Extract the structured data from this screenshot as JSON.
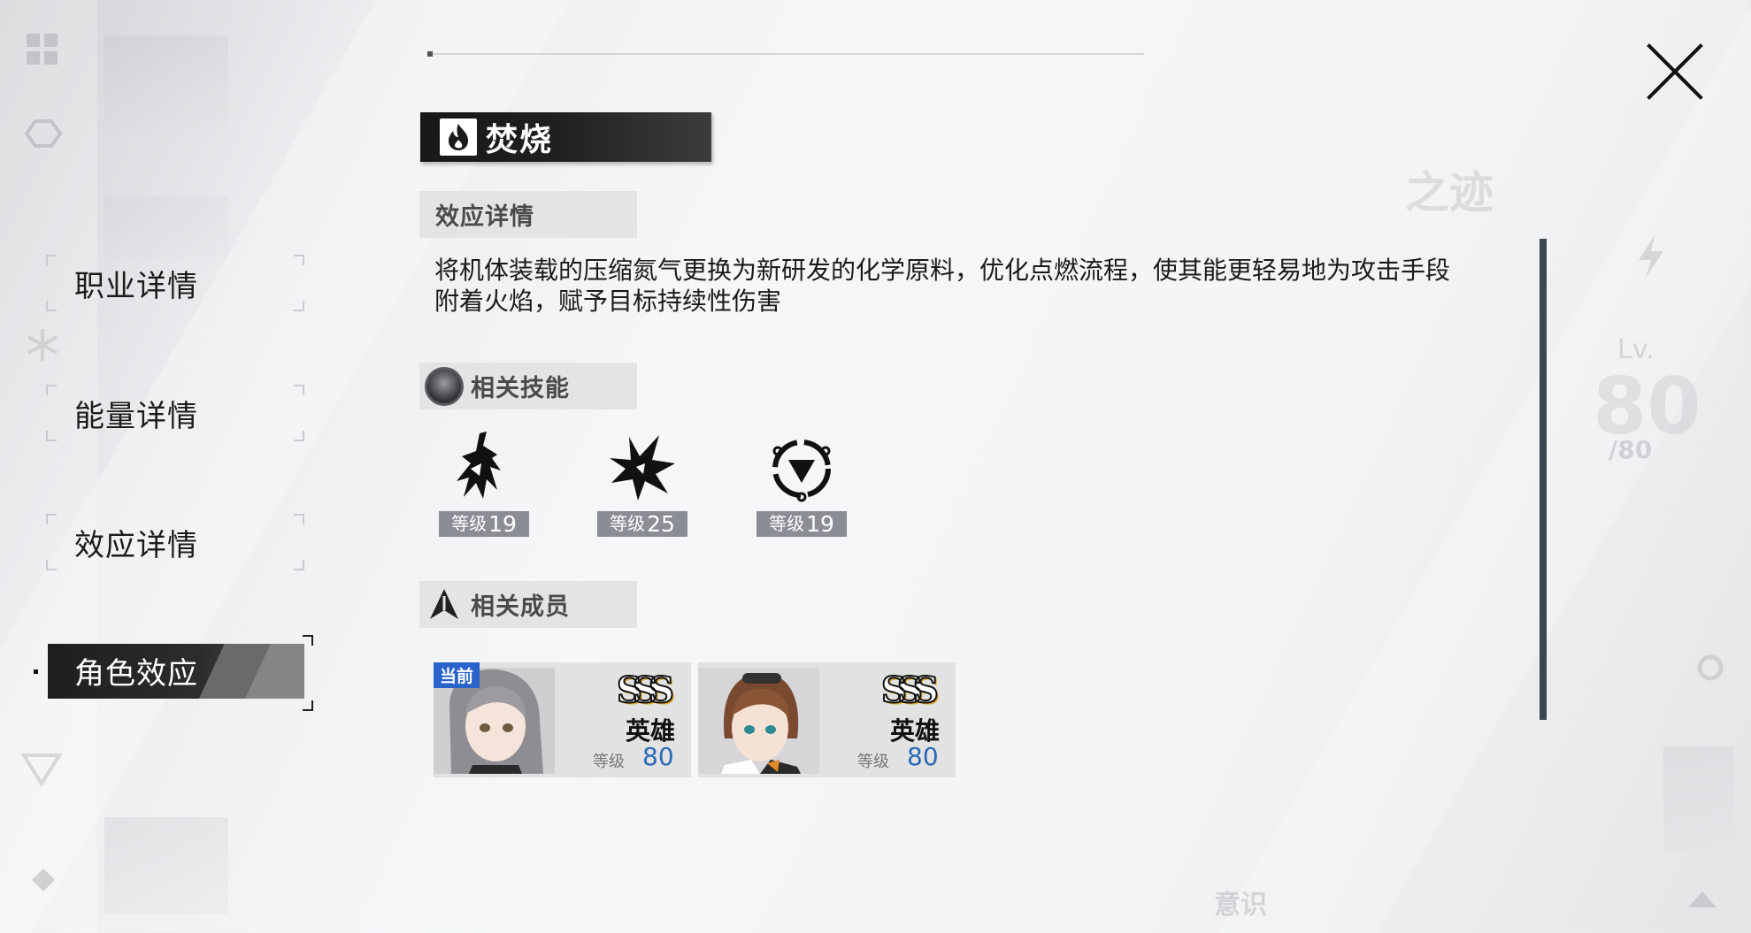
{
  "effect": {
    "title": "焚烧",
    "icon": "flame-icon"
  },
  "nav": {
    "items": [
      {
        "label": "职业详情",
        "active": false
      },
      {
        "label": "能量详情",
        "active": false
      },
      {
        "label": "效应详情",
        "active": false
      },
      {
        "label": "角色效应",
        "active": true
      }
    ]
  },
  "sections": {
    "details_title": "效应详情",
    "description_line1": "将机体装载的压缩氮气更换为新研发的化学原料，优化点燃流程，使其能更轻易地为攻击手段",
    "description_line2": "附着火焰，赋予目标持续性伤害",
    "skills_title": "相关技能",
    "members_title": "相关成员"
  },
  "skills": [
    {
      "level_label": "等级",
      "level": "19",
      "icon": "skill-dash-icon"
    },
    {
      "level_label": "等级",
      "level": "25",
      "icon": "skill-burst-icon"
    },
    {
      "level_label": "等级",
      "level": "19",
      "icon": "skill-triangle-icon"
    }
  ],
  "members": [
    {
      "badge": "当前",
      "rank": "SSS",
      "role": "英雄",
      "level_label": "等级",
      "level": "80"
    },
    {
      "badge": "",
      "rank": "SSS",
      "role": "英雄",
      "level_label": "等级",
      "level": "80"
    }
  ],
  "background": {
    "level_label": "Lv.",
    "level_value": "80",
    "level_sub": "/80",
    "faded_title": "之迹",
    "bottom_label": "意识"
  },
  "colors": {
    "accent_blue": "#2a63c9",
    "level_blue": "#2a6ab6",
    "dark_bar": "#1f1f1f",
    "scrollbar": "#3c4652"
  }
}
